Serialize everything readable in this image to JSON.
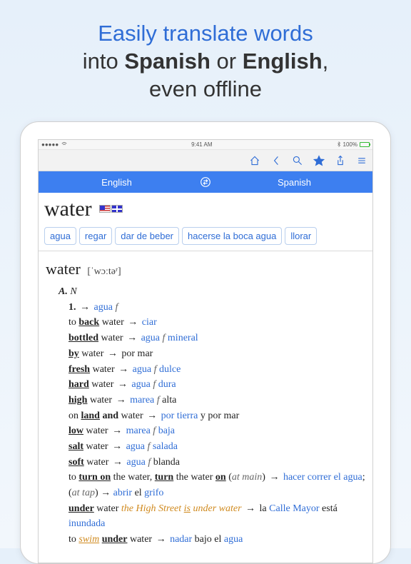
{
  "promo": {
    "line1_pre": "Easily translate words",
    "line2_pre": "into ",
    "lang1": "Spanish",
    "or": " or ",
    "lang2": "English",
    "comma": ",",
    "line3": "even offline"
  },
  "statusbar": {
    "carrier": "●●●●●",
    "wifi": "⏚",
    "time": "9:41 AM",
    "bt": "✱",
    "pct": "100%"
  },
  "langbar": {
    "left": "English",
    "right": "Spanish"
  },
  "headword": "water",
  "chips": [
    "agua",
    "regar",
    "dar de beber",
    "hacerse la boca agua",
    "llorar"
  ],
  "entry": {
    "headword2": "water",
    "phon": "[ˈwɔːtəʳ]",
    "section_label": "A.",
    "pos": "N",
    "sense_num": "1.",
    "sense_target": "agua",
    "sense_gender": "f",
    "rows": [
      {
        "src_html": "to <b><span class='uline'>back</span></b> water",
        "tgt_html": "<span class='tgt'>ciar</span>"
      },
      {
        "src_html": "<b><span class='uline'>bottled</span></b> water",
        "tgt_html": "<span class='tgt'>agua</span> <span class='g'>f</span> <span class='tgt'>mineral</span>"
      },
      {
        "src_html": "<b><span class='uline'>by</span></b> water",
        "tgt_html": "por mar"
      },
      {
        "src_html": "<b><span class='uline'>fresh</span></b> water",
        "tgt_html": "<span class='tgt'>agua</span> <span class='g'>f</span> <span class='tgt'>dulce</span>"
      },
      {
        "src_html": "<b><span class='uline'>hard</span></b> water",
        "tgt_html": "<span class='tgt'>agua</span> <span class='g'>f</span> <span class='tgt'>dura</span>"
      },
      {
        "src_html": "<b><span class='uline'>high</span></b> water",
        "tgt_html": "<span class='tgt'>marea</span> <span class='g'>f</span> alta"
      },
      {
        "src_html": "on <b><span class='uline'>land</span> and</b> water",
        "tgt_html": "<span class='tgt'>por tierra</span> y por mar"
      },
      {
        "src_html": "<b><span class='uline'>low</span></b> water",
        "tgt_html": "<span class='tgt'>marea</span> <span class='g'>f</span> <span class='tgt'>baja</span>"
      },
      {
        "src_html": "<b><span class='uline'>salt</span></b> water",
        "tgt_html": "<span class='tgt'>agua</span> <span class='g'>f</span> <span class='tgt'>salada</span>"
      },
      {
        "src_html": "<b><span class='uline'>soft</span></b> water",
        "tgt_html": "<span class='tgt'>agua</span> <span class='g'>f</span> blanda"
      },
      {
        "src_html": "to <b><span class='uline'>turn on</span></b> the water, <b><span class='uline'>turn</span></b> the water <b><span class='uline'>on</span></b> (<span class='g'>at main</span>)",
        "tgt_html": "<span class='tgt'>hacer correr el agua</span>; (<span class='g'>at tap</span>) → <span class='tgt'>abrir</span> el <span class='tgt'>grifo</span>",
        "multi": true
      },
      {
        "src_html": "<b><span class='uline'>under</span></b> water <span class='orange'>the High Street <span class='uline'>is</span> under water</span>",
        "tgt_html": "la <span class='tgt'>Calle Mayor</span> está <span class='tgt'>inundada</span>",
        "multi": true
      },
      {
        "src_html": "to <span class='orange uline'>swim</span> <b><span class='uline'>under</span></b> water",
        "tgt_html": "<span class='tgt'>nadar</span> bajo el <span class='tgt'>agua</span>"
      }
    ]
  }
}
